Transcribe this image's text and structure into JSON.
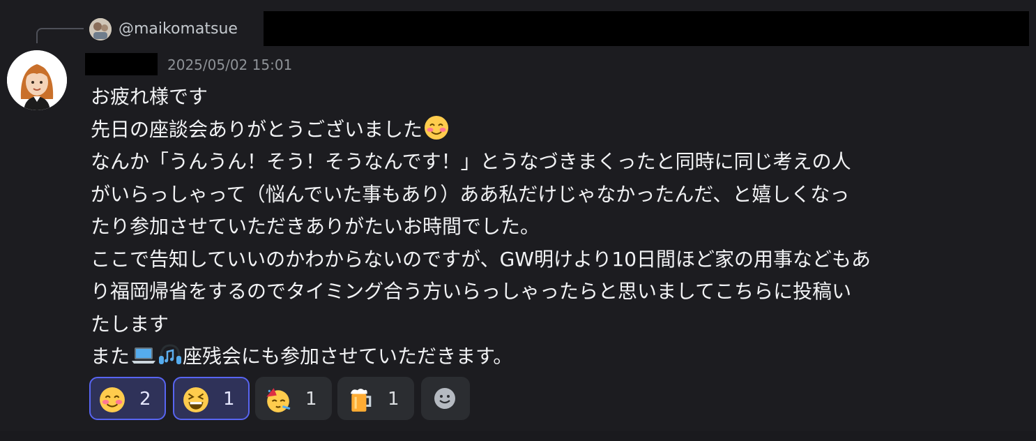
{
  "reply": {
    "handle": "@maikomatsue"
  },
  "message": {
    "timestamp": "2025/05/02 15:01",
    "lines": [
      "お疲れ様です",
      "先日の座談会ありがとうございました",
      "なんか「うんうん！そう！そうなんです！」とうなづきまくったと同時に同じ考えの人",
      "がいらっしゃって（悩んでいた事もあり）ああ私だけじゃなかったんだ、と嬉しくなっ",
      "たり参加させていただきありがたいお時間でした。",
      "ここで告知していいのかわからないのですが、GW明けより10日間ほど家の用事などもあ",
      "り福岡帰省をするのでタイミング合う方いらっしゃったらと思いましてこちらに投稿い",
      "たします",
      "また",
      "座残会にも参加させていただきます。"
    ],
    "inline_emojis": {
      "line2": "smiling-blush-emoji",
      "line9_a": "laptop-emoji",
      "line9_b": "headphones-music-emoji"
    }
  },
  "reactions": [
    {
      "emoji": "smiling-blush-emoji",
      "count": "2",
      "active": true
    },
    {
      "emoji": "grinning-squint-emoji",
      "count": "1",
      "active": true
    },
    {
      "emoji": "partying-face-emoji",
      "count": "1",
      "active": false
    },
    {
      "emoji": "beer-mug-emoji",
      "count": "1",
      "active": false
    }
  ],
  "add_reaction": {
    "icon": "add-reaction-icon"
  },
  "colors": {
    "background": "#1c1c20",
    "text": "#f2f3f5",
    "muted": "#8e9297",
    "reaction_bg": "#2b2d31",
    "reaction_active_bg": "#2f3259",
    "reaction_active_border": "#5865f2"
  }
}
